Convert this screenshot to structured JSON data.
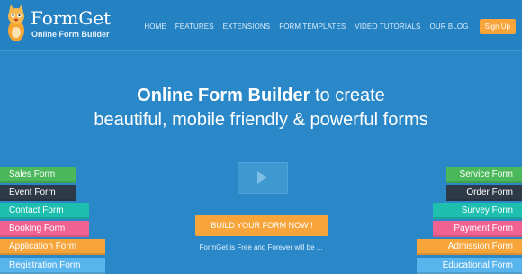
{
  "header": {
    "brand": "FormGet",
    "tagline": "Online Form Builder",
    "nav": [
      "HOME",
      "FEATURES",
      "EXTENSIONS",
      "FORM TEMPLATES",
      "VIDEO TUTORIALS",
      "OUR BLOG"
    ],
    "signup": "Sign Up"
  },
  "hero": {
    "headline_bold": "Online Form Builder",
    "headline_rest": " to create",
    "subline": "beautiful, mobile friendly & powerful forms",
    "cta": "BUILD YOUR FORM NOW !",
    "free_text": "FormGet is Free and Forever will be ..."
  },
  "left_forms": [
    {
      "label": "Sales Form",
      "color": "#4cb85c"
    },
    {
      "label": "Event Form",
      "color": "#2f3a48"
    },
    {
      "label": "Contact Form",
      "color": "#1fbfb0"
    },
    {
      "label": "Booking Form",
      "color": "#f06292"
    },
    {
      "label": "Application Form",
      "color": "#f7a43b"
    },
    {
      "label": "Registration Form",
      "color": "#58b4ec"
    }
  ],
  "right_forms": [
    {
      "label": "Service Form",
      "color": "#4cb85c"
    },
    {
      "label": "Order Form",
      "color": "#2f3a48"
    },
    {
      "label": "Survey Form",
      "color": "#1fbfb0"
    },
    {
      "label": "Payment Form",
      "color": "#f06292"
    },
    {
      "label": "Admission Form",
      "color": "#f7a43b"
    },
    {
      "label": "Educational Form",
      "color": "#58b4ec"
    }
  ],
  "icons": {
    "logo": "formget-cat-logo",
    "video": "play-icon"
  }
}
